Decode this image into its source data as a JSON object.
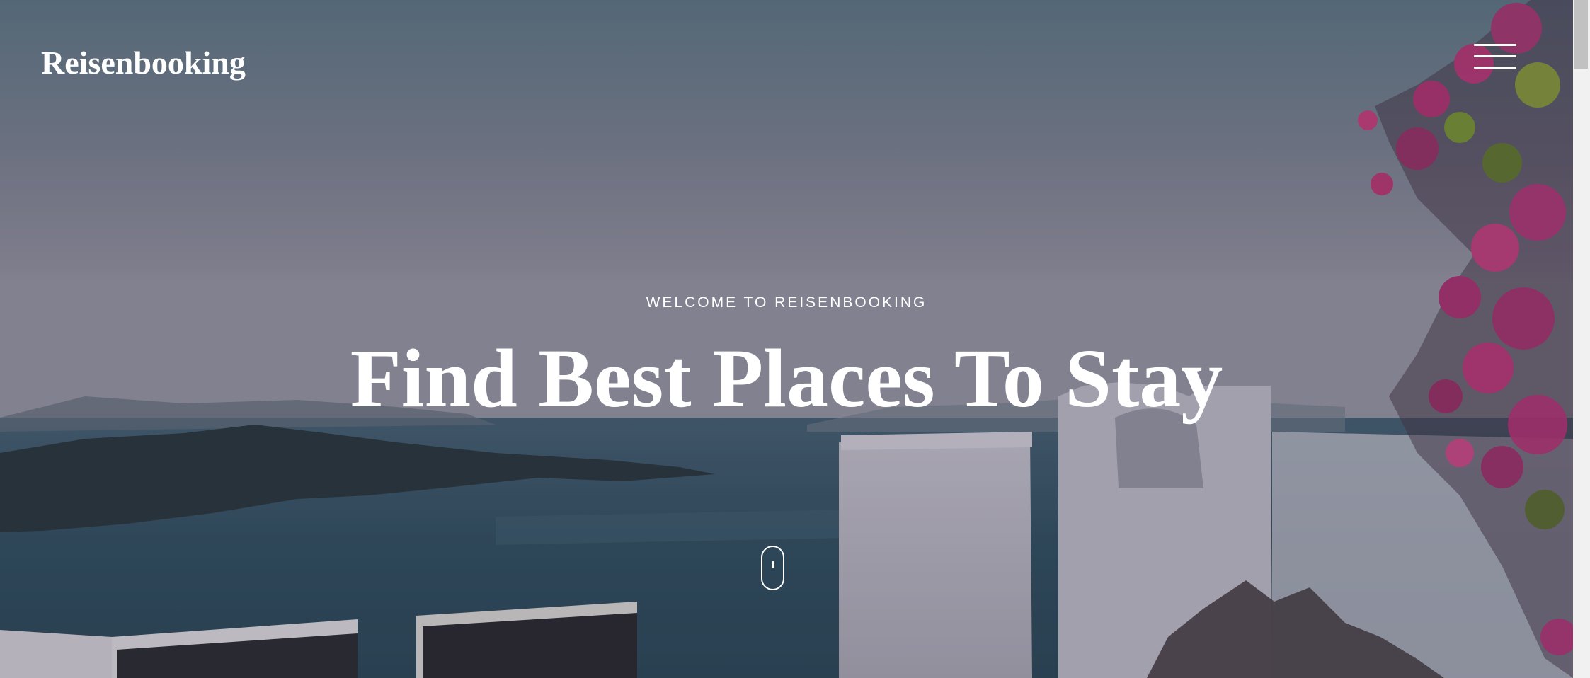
{
  "brand": {
    "name": "Reisenbooking"
  },
  "nav": {
    "menu_icon": "hamburger-menu-icon"
  },
  "hero": {
    "eyebrow": "WELCOME TO REISENBOOKING",
    "headline": "Find Best Places To Stay",
    "scroll_icon": "scroll-mouse-icon"
  },
  "colors": {
    "text": "#ffffff",
    "overlay": "#6f7080",
    "scrollbar_track": "#f1f1f1",
    "scrollbar_thumb": "#c1c1c1"
  }
}
